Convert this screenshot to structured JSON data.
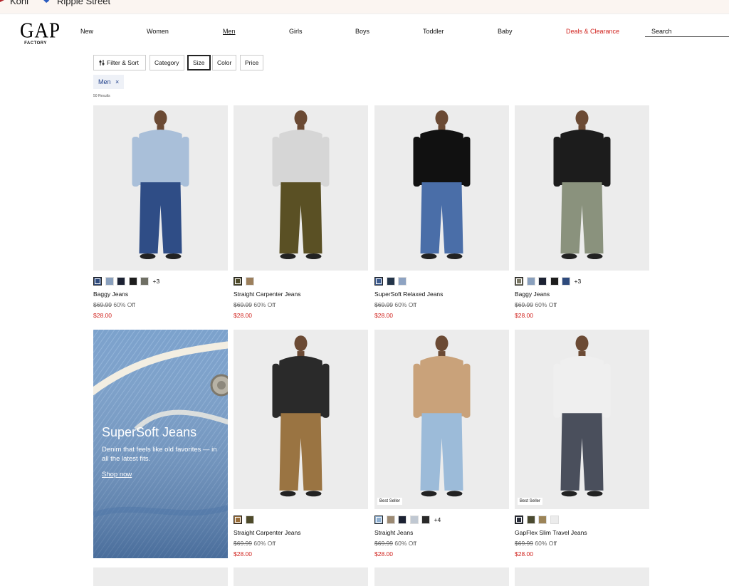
{
  "topbar": {
    "left_text": "Kohl",
    "right_text": "Ripple Street"
  },
  "brand": {
    "logo": "GAP",
    "logo_sub": "FACTORY"
  },
  "nav": {
    "items": [
      "New",
      "Women",
      "Men",
      "Girls",
      "Boys",
      "Toddler",
      "Baby",
      "Deals & Clearance"
    ],
    "active": "Men"
  },
  "search": {
    "placeholder": "Search"
  },
  "filters": {
    "filter_sort": "Filter & Sort",
    "category": "Category",
    "size": "Size",
    "color": "Color",
    "price": "Price"
  },
  "applied_filter": {
    "label": "Men",
    "remove": "×"
  },
  "results_count": "50 Results",
  "products": [
    {
      "name": "Baggy Jeans",
      "old_price": "$69.99",
      "discount": "60% Off",
      "price": "$28.00",
      "more": "+3",
      "swatches": [
        "#2e4a7c",
        "#8aa0bd",
        "#1c2233",
        "#1d1d1d",
        "#6f6f64"
      ],
      "shirt": "#a9bfd9",
      "pants": "#2f4d86",
      "badge": ""
    },
    {
      "name": "Straight Carpenter Jeans",
      "old_price": "$69.99",
      "discount": "60% Off",
      "price": "$28.00",
      "more": "",
      "swatches": [
        "#4e4a2a",
        "#9c7f5c"
      ],
      "shirt": "#d6d6d6",
      "pants": "#5a5024",
      "badge": ""
    },
    {
      "name": "SuperSoft Relaxed Jeans",
      "old_price": "$69.99",
      "discount": "60% Off",
      "price": "$28.00",
      "more": "",
      "swatches": [
        "#3c5a8d",
        "#233449",
        "#8ea3c2"
      ],
      "shirt": "#111111",
      "pants": "#4a6ea8",
      "badge": ""
    },
    {
      "name": "Baggy Jeans",
      "old_price": "$69.99",
      "discount": "60% Off",
      "price": "$28.00",
      "more": "+3",
      "swatches": [
        "#7c7a68",
        "#8aa0bd",
        "#1c2233",
        "#1d1d1d",
        "#2e4a7c"
      ],
      "shirt": "#1c1c1c",
      "pants": "#8a927d",
      "badge": ""
    },
    {
      "name": "Straight Carpenter Jeans",
      "old_price": "$69.99",
      "discount": "60% Off",
      "price": "$28.00",
      "more": "",
      "swatches": [
        "#9a6e3a",
        "#4e4a2a"
      ],
      "shirt": "#2a2a2a",
      "pants": "#9a7442",
      "badge": ""
    },
    {
      "name": "Straight Jeans",
      "old_price": "$69.99",
      "discount": "60% Off",
      "price": "$28.00",
      "more": "+4",
      "swatches": [
        "#8fb0d2",
        "#9c8a74",
        "#1c2233",
        "#c0c8d2",
        "#2a2a2a"
      ],
      "shirt": "#c9a27a",
      "pants": "#9cbbd9",
      "badge": "Best Seller"
    },
    {
      "name": "GapFlex Slim Travel Jeans",
      "old_price": "$69.99",
      "discount": "60% Off",
      "price": "$28.00",
      "more": "",
      "swatches": [
        "#2a2f3c",
        "#4a4a30",
        "#9c8458",
        "#ececec"
      ],
      "shirt": "#efefef",
      "pants": "#4a4f5c",
      "badge": "Best Seller"
    }
  ],
  "promo": {
    "title": "SuperSoft Jeans",
    "subtitle": "Denim that feels like old favorites — in all the latest fits.",
    "cta": "Shop now"
  },
  "colors": {
    "sale": "#d0211c",
    "applied_filter_text": "#1f3f8a"
  }
}
